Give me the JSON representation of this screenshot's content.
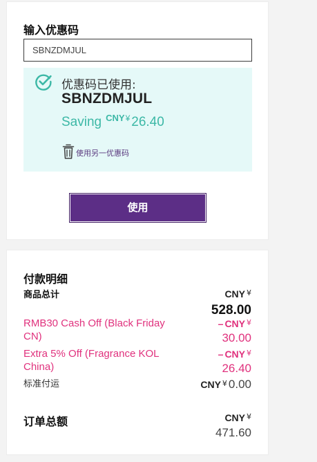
{
  "promo": {
    "title": "输入优惠码",
    "input_value": "SBNZDMJUL",
    "applied_label": "优惠码已使用:",
    "applied_code": "SBNZDMJUL",
    "saving_label": "Saving",
    "saving_currency": "CNY",
    "saving_symbol": "¥",
    "saving_amount": "26.40",
    "remove_label": "使用另一优惠码",
    "apply_button": "使用"
  },
  "summary": {
    "title": "付款明细",
    "subtotal": {
      "label": "商品总计",
      "currency": "CNY",
      "symbol": "¥",
      "amount": "528.00"
    },
    "discounts": [
      {
        "label": "RMB30 Cash Off (Black Friday CN)",
        "sign": "–",
        "currency": "CNY",
        "symbol": "¥",
        "amount": "30.00"
      },
      {
        "label": "Extra 5% Off (Fragrance KOL China)",
        "sign": "–",
        "currency": "CNY",
        "symbol": "¥",
        "amount": "26.40"
      }
    ],
    "shipping": {
      "label": "标准付运",
      "currency": "CNY",
      "symbol": "¥",
      "amount": "0.00"
    },
    "total": {
      "label": "订单总额",
      "currency": "CNY",
      "symbol": "¥",
      "amount": "471.60"
    }
  },
  "colors": {
    "accent_purple": "#5c2e86",
    "discount_pink": "#e0317d",
    "saving_teal": "#3cb8a6",
    "applied_bg": "#e5f9f8"
  },
  "icons": {
    "applied": "check-circle-icon",
    "remove": "trash-icon"
  }
}
